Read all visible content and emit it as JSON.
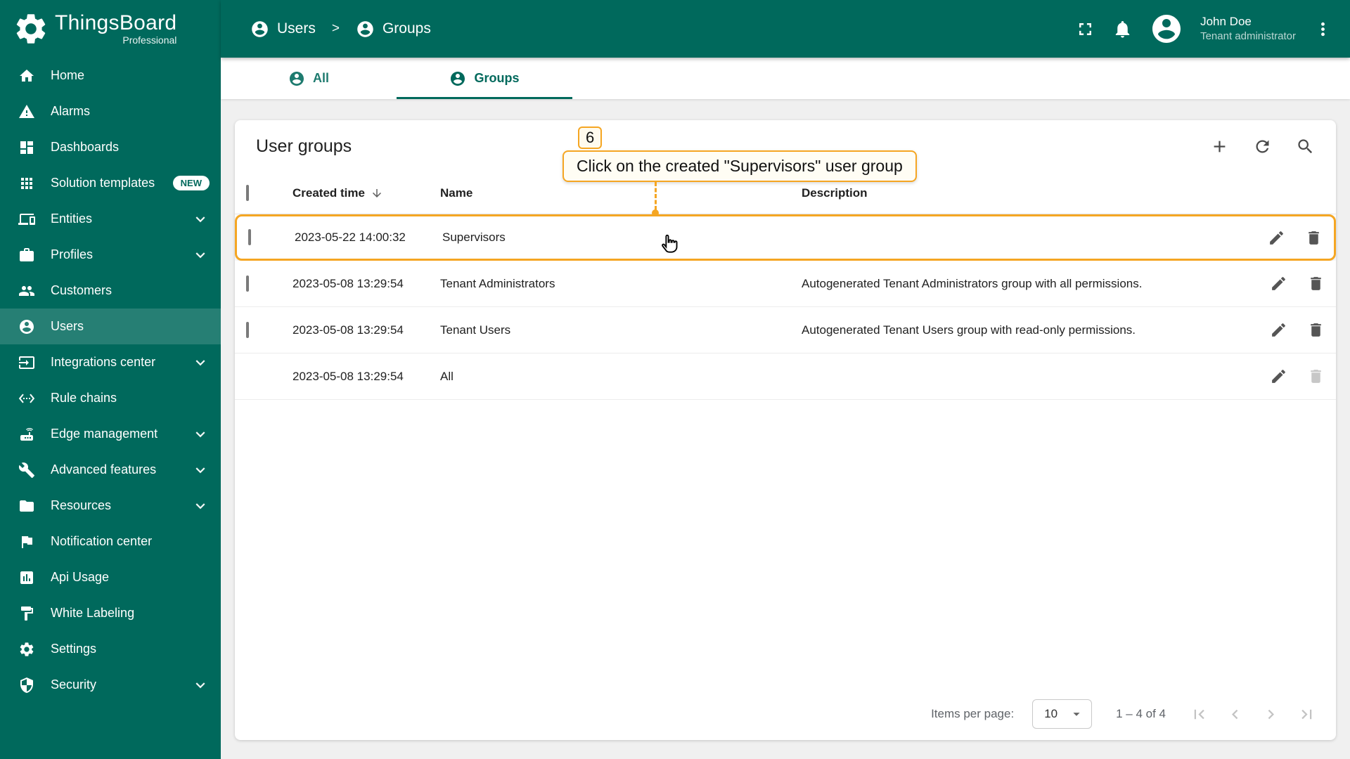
{
  "colors": {
    "primary": "#00695c",
    "annotation_accent": "#f5a623"
  },
  "brand": {
    "name": "ThingsBoard",
    "edition": "Professional"
  },
  "header": {
    "breadcrumb": [
      {
        "label": "Users"
      },
      {
        "label": "Groups"
      }
    ],
    "user_name": "John Doe",
    "user_role": "Tenant administrator"
  },
  "sidebar": {
    "items": [
      {
        "label": "Home"
      },
      {
        "label": "Alarms"
      },
      {
        "label": "Dashboards"
      },
      {
        "label": "Solution templates",
        "badge": "NEW"
      },
      {
        "label": "Entities"
      },
      {
        "label": "Profiles"
      },
      {
        "label": "Customers"
      },
      {
        "label": "Users"
      },
      {
        "label": "Integrations center"
      },
      {
        "label": "Rule chains"
      },
      {
        "label": "Edge management"
      },
      {
        "label": "Advanced features"
      },
      {
        "label": "Resources"
      },
      {
        "label": "Notification center"
      },
      {
        "label": "Api Usage"
      },
      {
        "label": "White Labeling"
      },
      {
        "label": "Settings"
      },
      {
        "label": "Security"
      }
    ]
  },
  "tabs": {
    "all": "All",
    "groups": "Groups"
  },
  "page": {
    "title": "User groups",
    "columns": {
      "created": "Created time",
      "name": "Name",
      "description": "Description"
    },
    "rows": [
      {
        "created": "2023-05-22 14:00:32",
        "name": "Supervisors",
        "description": ""
      },
      {
        "created": "2023-05-08 13:29:54",
        "name": "Tenant Administrators",
        "description": "Autogenerated Tenant Administrators group with all permissions."
      },
      {
        "created": "2023-05-08 13:29:54",
        "name": "Tenant Users",
        "description": "Autogenerated Tenant Users group with read-only permissions."
      },
      {
        "created": "2023-05-08 13:29:54",
        "name": "All",
        "description": ""
      }
    ],
    "pagination": {
      "label": "Items per page:",
      "per_page": "10",
      "range": "1 – 4 of 4"
    }
  },
  "annotation": {
    "step": "6",
    "text": "Click on the created \"Supervisors\" user group"
  }
}
